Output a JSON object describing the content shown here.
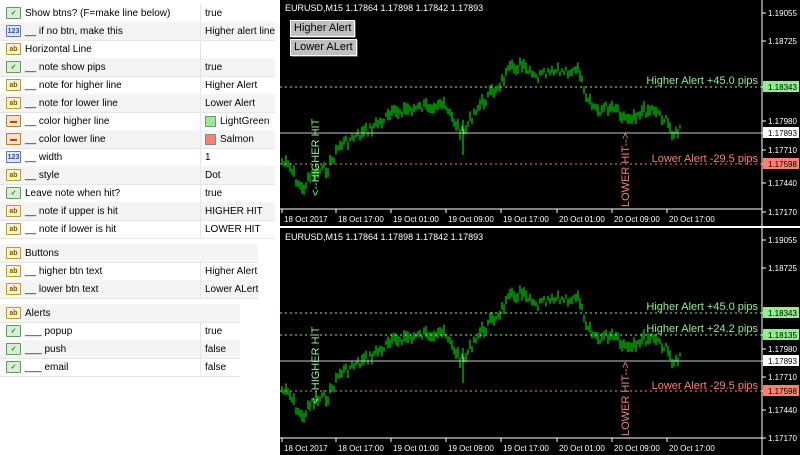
{
  "props": {
    "r1": {
      "label": "Show btns? (F=make line below)",
      "value": "true"
    },
    "r2": {
      "label": "__ if no btn, make this",
      "value": "Higher alert line"
    },
    "r3": {
      "label": "Horizontal Line",
      "value": ""
    },
    "r4": {
      "label": "__ note show pips",
      "value": "true"
    },
    "r5": {
      "label": "__ note for higher line",
      "value": "Higher Alert"
    },
    "r6": {
      "label": "__ note for lower line",
      "value": "Lower Alert"
    },
    "r7": {
      "label": "__ color higher line",
      "value": "LightGreen"
    },
    "r8": {
      "label": "__ color lower line",
      "value": "Salmon"
    },
    "r9": {
      "label": "__ width",
      "value": "1"
    },
    "r10": {
      "label": "__ style",
      "value": "Dot"
    },
    "r11": {
      "label": "Leave note when hit?",
      "value": "true"
    },
    "r12": {
      "label": "__ note if upper is hit",
      "value": "HIGHER HIT"
    },
    "r13": {
      "label": "__ note if lower is hit",
      "value": "LOWER HIT"
    },
    "b0": {
      "label": "Buttons"
    },
    "b1": {
      "label": "__ higher btn text",
      "value": "Higher Alert"
    },
    "b2": {
      "label": "__ lower btn text",
      "value": "Lower ALert"
    },
    "a0": {
      "label": "Alerts"
    },
    "a1": {
      "label": "___ popup",
      "value": "true"
    },
    "a2": {
      "label": "___ push",
      "value": "false"
    },
    "a3": {
      "label": "___ email",
      "value": "false"
    }
  },
  "colors": {
    "higher_line": "#90EE90",
    "lower_line": "#FA8072",
    "candle": "#00FF00",
    "grid_text": "#ffffff",
    "chart_bg": "#000000"
  },
  "chart_top": {
    "header": "EURUSD,M15  1.17864 1.17898 1.17842 1.17893",
    "btn_higher": "Higher Alert",
    "btn_lower": "Lower ALert",
    "higher_label": "Higher Alert +45.0 pips",
    "lower_label": "Lower Alert -29.5 pips",
    "higher_hit": "<--HIGHER HIT",
    "lower_hit": "LOWER HIT-->",
    "price_ticks": [
      "1.19055",
      "1.18725",
      "1.18343",
      "1.17980",
      "1.17893",
      "1.17710",
      "1.17598",
      "1.17440",
      "1.17170"
    ],
    "time_ticks": [
      "18 Oct 2017",
      "18 Oct 17:00",
      "19 Oct 01:00",
      "19 Oct 09:00",
      "19 Oct 17:00",
      "20 Oct 01:00",
      "20 Oct 09:00",
      "20 Oct 17:00"
    ]
  },
  "chart_bottom": {
    "header": "EURUSD,M15  1.17864 1.17898 1.17842 1.17893",
    "higher_label": "Higher Alert +45.0 pips",
    "mid_label": "Higher Alert +24.2 pips",
    "lower_label": "Lower Alert -29.5 pips",
    "higher_hit": "<--HIGHER HIT",
    "lower_hit": "LOWER HIT-->",
    "price_ticks": [
      "1.19055",
      "1.18725",
      "1.18343",
      "1.18135",
      "1.17980",
      "1.17893",
      "1.17710",
      "1.17598",
      "1.17440",
      "1.17170"
    ],
    "time_ticks": [
      "18 Oct 2017",
      "18 Oct 17:00",
      "19 Oct 01:00",
      "19 Oct 09:00",
      "19 Oct 17:00",
      "20 Oct 01:00",
      "20 Oct 09:00",
      "20 Oct 17:00"
    ]
  },
  "chart_data": [
    {
      "type": "line",
      "title": "EURUSD,M15",
      "ylim": [
        1.1717,
        1.1906
      ],
      "levels": {
        "higher": 1.18343,
        "lower": 1.17598,
        "current": 1.17893
      },
      "x": [
        "18 Oct 2017",
        "18 Oct 17:00",
        "19 Oct 01:00",
        "19 Oct 09:00",
        "19 Oct 17:00",
        "20 Oct 01:00",
        "20 Oct 09:00",
        "20 Oct 17:00"
      ],
      "series": [
        {
          "values": [
            1.1776,
            1.1788,
            1.1815,
            1.1828,
            1.184,
            1.183,
            1.1805,
            1.1789
          ]
        }
      ]
    },
    {
      "type": "line",
      "title": "EURUSD,M15",
      "ylim": [
        1.1717,
        1.1906
      ],
      "levels": {
        "higher": 1.18343,
        "higher2": 1.18135,
        "lower": 1.17598,
        "current": 1.17893
      },
      "x": [
        "18 Oct 2017",
        "18 Oct 17:00",
        "19 Oct 01:00",
        "19 Oct 09:00",
        "19 Oct 17:00",
        "20 Oct 01:00",
        "20 Oct 09:00",
        "20 Oct 17:00"
      ],
      "series": [
        {
          "values": [
            1.1776,
            1.1788,
            1.1815,
            1.1828,
            1.184,
            1.183,
            1.1805,
            1.1789
          ]
        }
      ]
    }
  ]
}
